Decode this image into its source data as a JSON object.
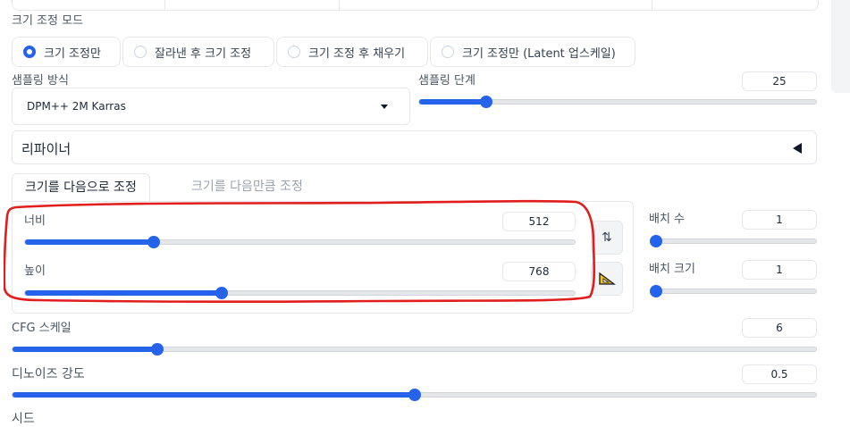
{
  "resize_mode": {
    "label": "크기 조정 모드",
    "options": [
      {
        "label": "크기 조정만",
        "selected": true
      },
      {
        "label": "잘라낸 후 크기 조정",
        "selected": false
      },
      {
        "label": "크기 조정 후 채우기",
        "selected": false
      },
      {
        "label": "크기 조정만 (Latent 업스케일)",
        "selected": false
      }
    ]
  },
  "sampling_method": {
    "label": "샘플링 방식",
    "value": "DPM++ 2M Karras"
  },
  "sampling_steps": {
    "label": "샘플링 단계",
    "value": "25",
    "fraction": 0.17
  },
  "refiner": {
    "label": "리파이너"
  },
  "tabs": [
    {
      "label": "크기를 다음으로 조정",
      "active": true
    },
    {
      "label": "크기를 다음만큼 조정",
      "active": false
    }
  ],
  "width": {
    "label": "너비",
    "value": "512",
    "fraction": 0.234
  },
  "height": {
    "label": "높이",
    "value": "768",
    "fraction": 0.358
  },
  "swap_button": {
    "icon": "swap-arrows-icon",
    "glyph": "⇅"
  },
  "ratio_button": {
    "icon": "triangle-ruler-icon"
  },
  "batch_count": {
    "label": "배치 수",
    "value": "1",
    "fraction": 0.0
  },
  "batch_size": {
    "label": "배치 크기",
    "value": "1",
    "fraction": 0.0
  },
  "cfg_scale": {
    "label": "CFG 스케일",
    "value": "6",
    "fraction": 0.18
  },
  "denoising": {
    "label": "디노이즈 강도",
    "value": "0.5",
    "fraction": 0.5
  },
  "seed": {
    "label": "시드"
  },
  "colors": {
    "accent": "#2563eb",
    "annotation": "#e11d1d",
    "border": "#e5e7eb"
  }
}
